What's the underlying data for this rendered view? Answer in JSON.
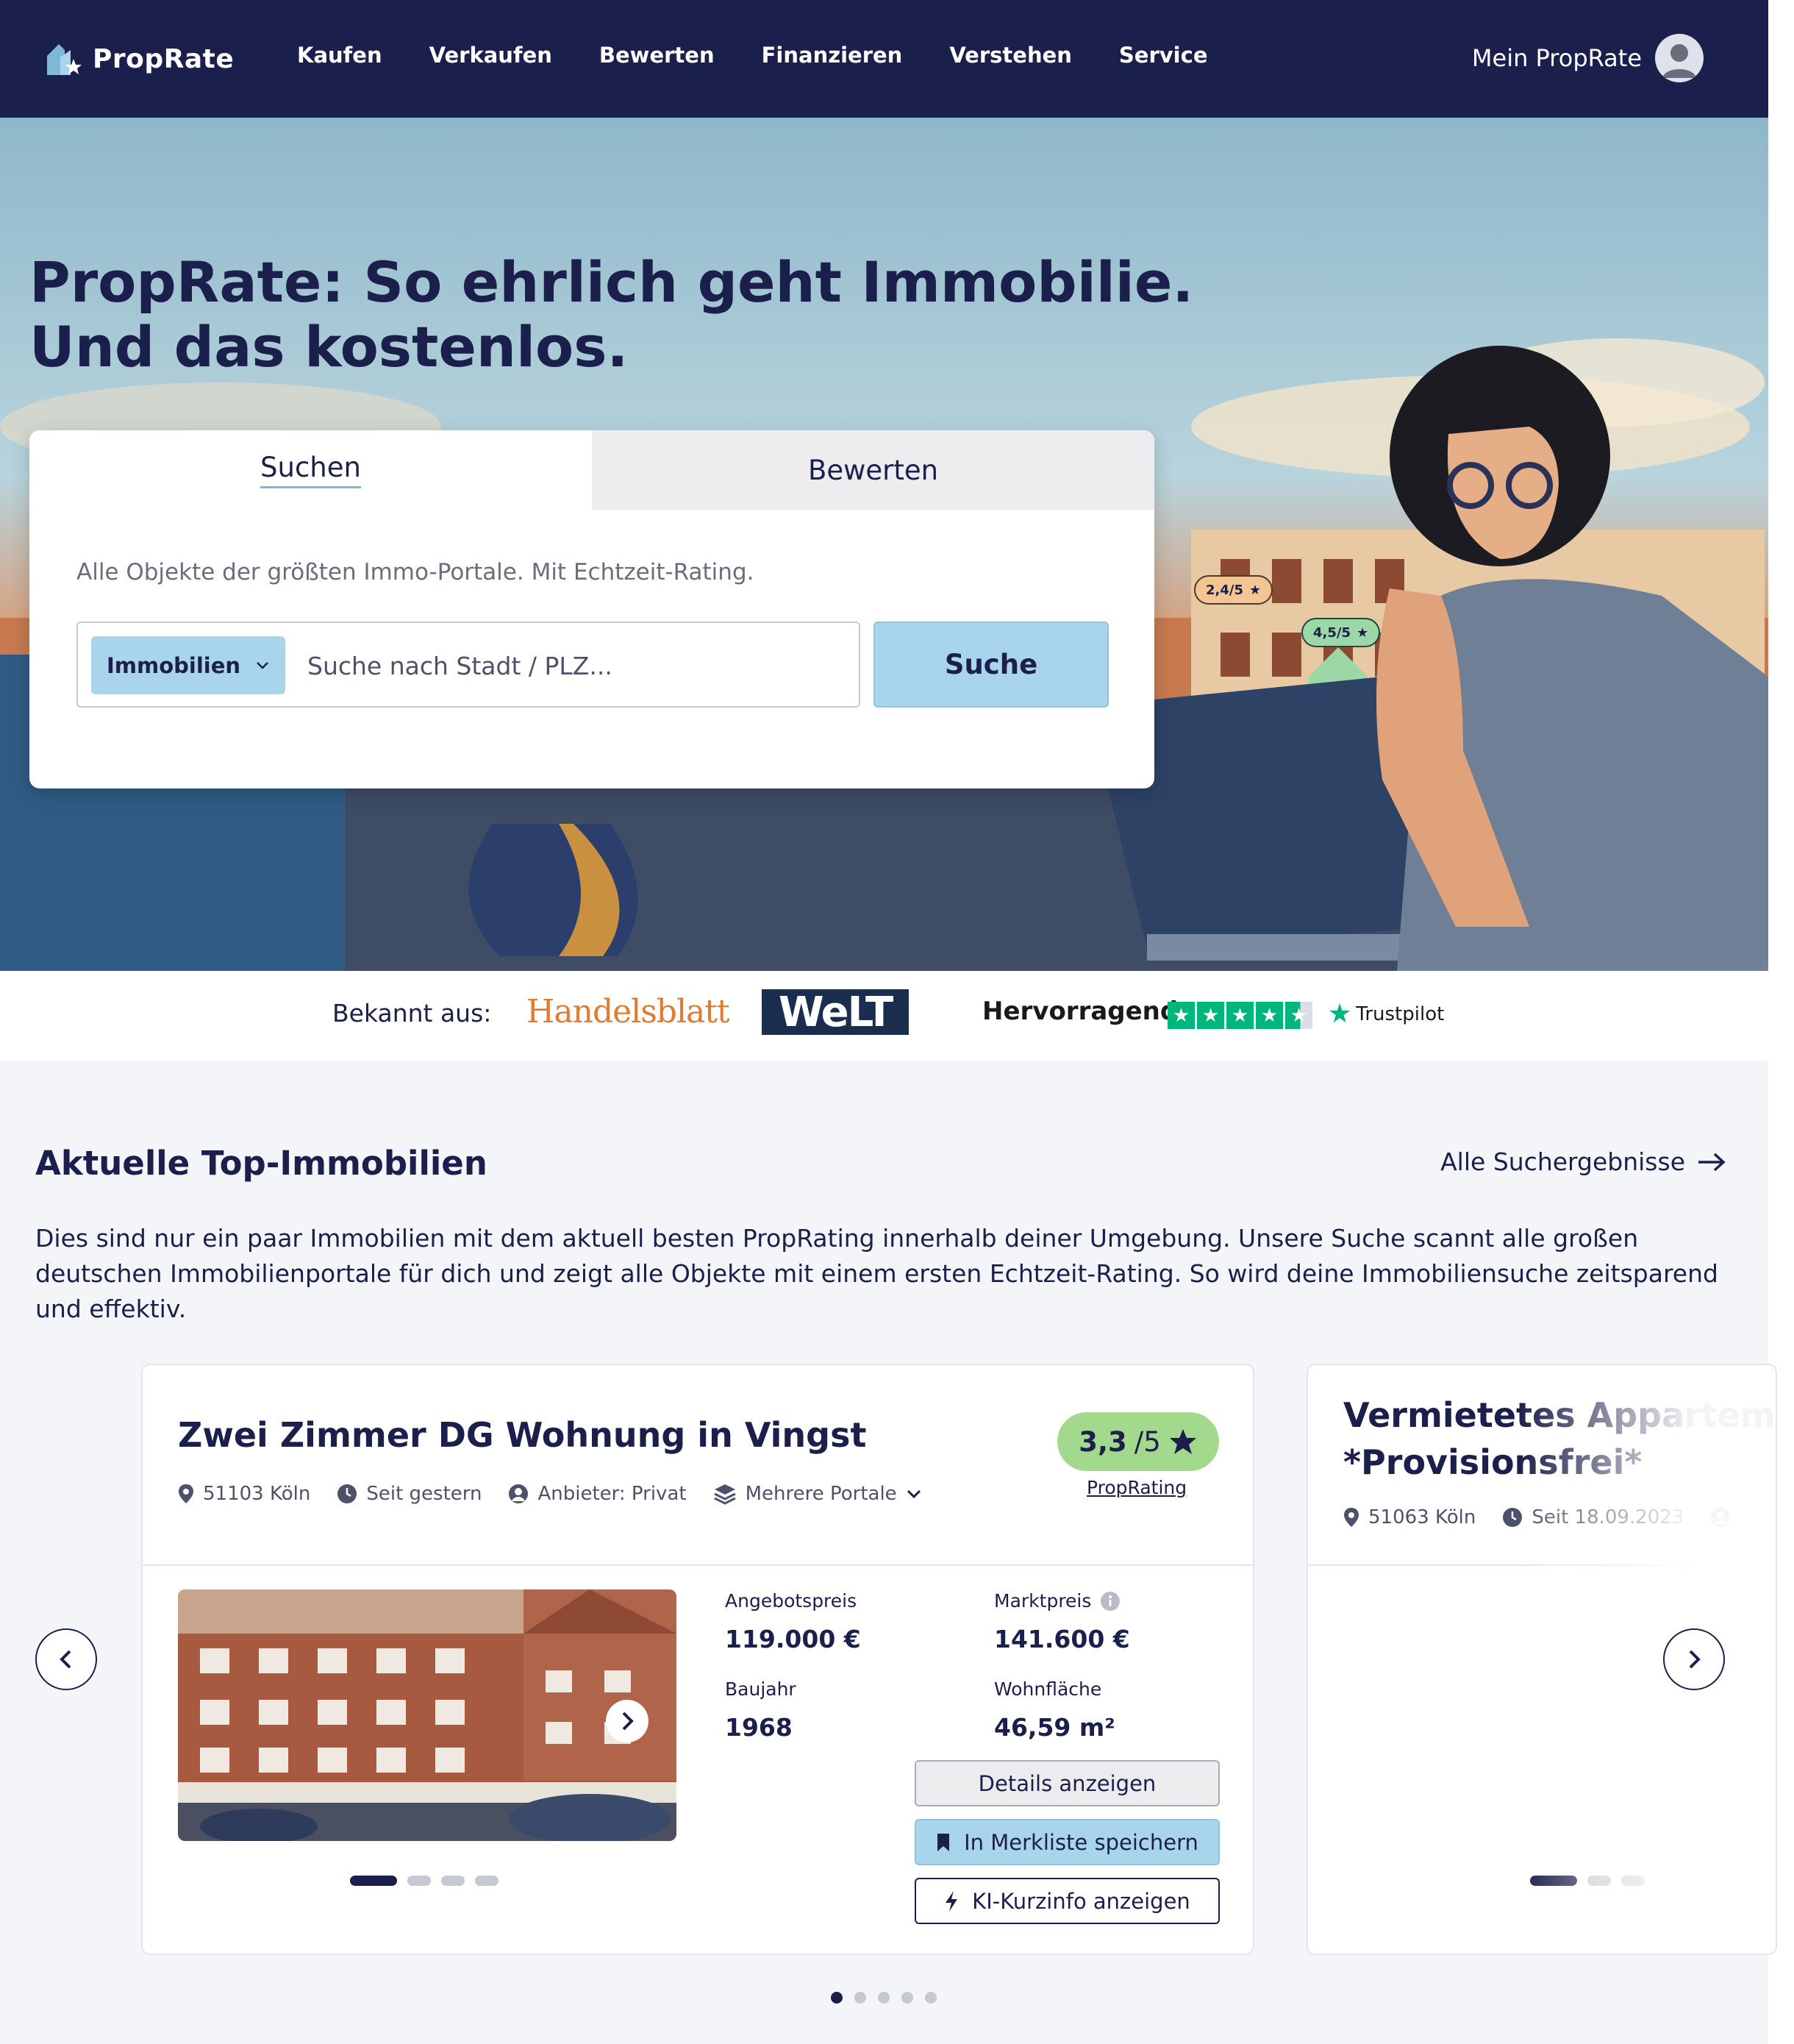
{
  "nav": {
    "logo_text": "PropRate",
    "items": [
      "Kaufen",
      "Verkaufen",
      "Bewerten",
      "Finanzieren",
      "Verstehen",
      "Service"
    ],
    "account_label": "Mein PropRate"
  },
  "hero": {
    "title_line1": "PropRate: So ehrlich geht Immobilie.",
    "title_line2": "Und das kostenlos.",
    "badges": [
      "2,4/5",
      "4,5/5"
    ],
    "tabs": [
      "Suchen",
      "Bewerten"
    ],
    "subtitle": "Alle Objekte der größten Immo-Portale. Mit Echtzeit-Rating.",
    "type_select": "Immobilien",
    "search_placeholder": "Suche nach Stadt / PLZ...",
    "search_button": "Suche"
  },
  "press": {
    "label": "Bekannt aus:",
    "handelsblatt": "Handelsblatt",
    "welt": "WeLT",
    "trustpilot_label": "Hervorragend",
    "trustpilot_stars": 4.5,
    "trustpilot_brand": "Trustpilot"
  },
  "section": {
    "title": "Aktuelle Top-Immobilien",
    "link": "Alle Suchergebnisse",
    "text": "Dies sind nur ein paar Immobilien mit dem aktuell besten PropRating innerhalb deiner Umgebung. Unsere Suche scannt alle großen deutschen Immobilienportale für dich und zeigt alle Objekte mit einem ersten Echtzeit-Rating. So wird deine Immobiliensuche zeitsparend und effektiv."
  },
  "listing": {
    "title": "Zwei Zimmer DG Wohnung in Vingst",
    "location": "51103 Köln",
    "since": "Seit gestern",
    "provider": "Anbieter: Privat",
    "portals": "Mehrere Portale",
    "rating": "3,3",
    "rating_max": "/5",
    "rating_link": "PropRating",
    "price_label": "Angebotspreis",
    "price": "119.000 €",
    "market_label": "Marktpreis",
    "market": "141.600 €",
    "year_label": "Baujahr",
    "year": "1968",
    "area_label": "Wohnfläche",
    "area": "46,59 m²",
    "btn_details": "Details anzeigen",
    "btn_save": "In Merkliste speichern",
    "btn_ki": "KI-Kurzinfo anzeigen",
    "photo_index": 1,
    "photo_count": 4
  },
  "listing2": {
    "title_line1": "Vermietetes Appartem",
    "title_line2": "*Provisionsfrei*",
    "location": "51063 Köln",
    "since": "Seit 18.09.2023"
  },
  "carousel": {
    "page": 1,
    "pages": 5
  },
  "colors": {
    "navy": "#1b1f4b",
    "accent_blue": "#a9d5ec",
    "rating_green": "#a3d98c",
    "trustpilot": "#00b67a"
  }
}
